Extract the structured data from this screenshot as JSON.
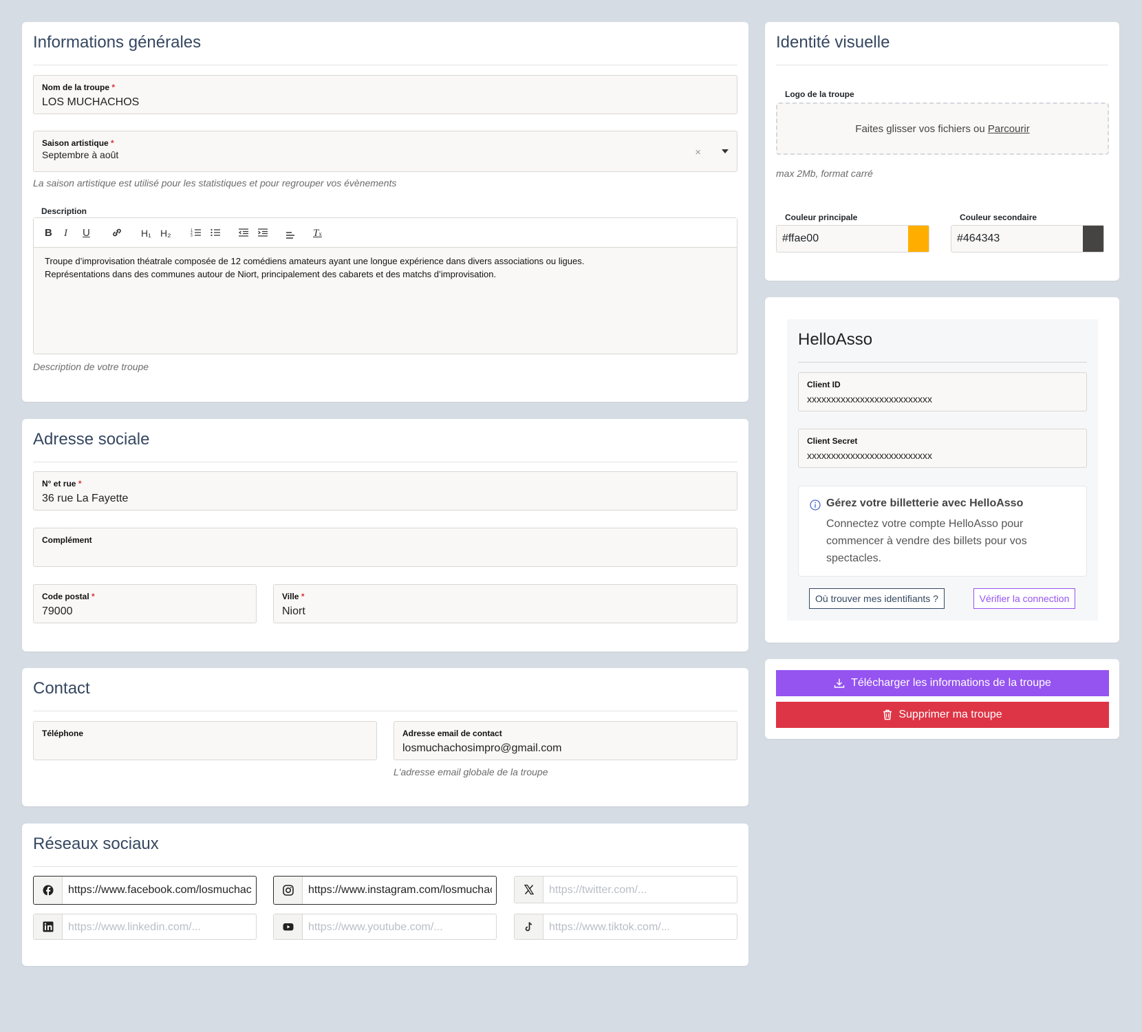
{
  "general": {
    "title": "Informations générales",
    "troupe_name_label": "Nom de la troupe",
    "troupe_name_value": "LOS MUCHACHOS",
    "season_label": "Saison artistique",
    "season_value": "Septembre à août",
    "season_clear": "×",
    "season_help": "La saison artistique est utilisé pour les statistiques et pour regrouper vos évènements",
    "description_label": "Description",
    "description_line1": "Troupe d’improvisation théatrale composée de 12 comédiens amateurs ayant une longue expérience dans divers associations ou ligues.",
    "description_line2": "Représentations dans des communes autour de Niort, principalement des cabarets et des matchs d’improvisation.",
    "description_help": "Description de votre troupe",
    "toolbar": {
      "bold": "B",
      "italic": "I",
      "underline": "U",
      "h1": "H₁",
      "h2": "H₂",
      "clear": "T"
    }
  },
  "address": {
    "title": "Adresse sociale",
    "street_label": "N° et rue",
    "street_value": "36 rue La Fayette",
    "complement_label": "Complément",
    "complement_value": "",
    "postal_label": "Code postal",
    "postal_value": "79000",
    "city_label": "Ville",
    "city_value": "Niort"
  },
  "contact": {
    "title": "Contact",
    "phone_label": "Téléphone",
    "phone_value": "",
    "email_label": "Adresse email de contact",
    "email_value": "losmuchachosimpro@gmail.com",
    "email_help": "L'adresse email globale de la troupe"
  },
  "social": {
    "title": "Réseaux sociaux",
    "facebook": {
      "icon": "facebook-icon",
      "value": "https://www.facebook.com/losmuchachosimpro"
    },
    "instagram": {
      "icon": "instagram-icon",
      "value": "https://www.instagram.com/losmuchachosimpro"
    },
    "twitter": {
      "icon": "x-icon",
      "placeholder": "https://twitter.com/..."
    },
    "linkedin": {
      "icon": "linkedin-icon",
      "placeholder": "https://www.linkedin.com/..."
    },
    "youtube": {
      "icon": "youtube-icon",
      "placeholder": "https://www.youtube.com/..."
    },
    "tiktok": {
      "icon": "tiktok-icon",
      "placeholder": "https://www.tiktok.com/..."
    }
  },
  "visual": {
    "title": "Identité visuelle",
    "logo_label": "Logo de la troupe",
    "dropzone_text": "Faites glisser vos fichiers ou",
    "dropzone_link": "Parcourir",
    "logo_help": "max 2Mb, format carré",
    "primary_label": "Couleur principale",
    "primary_value": "#ffae00",
    "secondary_label": "Couleur secondaire",
    "secondary_value": "#464343"
  },
  "helloasso": {
    "title": "HelloAsso",
    "client_id_label": "Client ID",
    "client_id_value": "xxxxxxxxxxxxxxxxxxxxxxxxxx",
    "client_secret_label": "Client Secret",
    "client_secret_value": "xxxxxxxxxxxxxxxxxxxxxxxxxx",
    "info_title": "Gérez votre billetterie avec HelloAsso",
    "info_text": "Connectez votre compte HelloAsso pour commencer à vendre des billets pour vos spectacles.",
    "find_ids_button": "Où trouver mes identifiants ?",
    "verify_button": "Vérifier la connection"
  },
  "actions": {
    "download_button": "Télécharger les informations de la troupe",
    "delete_button": "Supprimer ma troupe"
  },
  "colors": {
    "accent_purple": "#9553f0",
    "danger_red": "#dd3545",
    "heading": "#354760"
  }
}
